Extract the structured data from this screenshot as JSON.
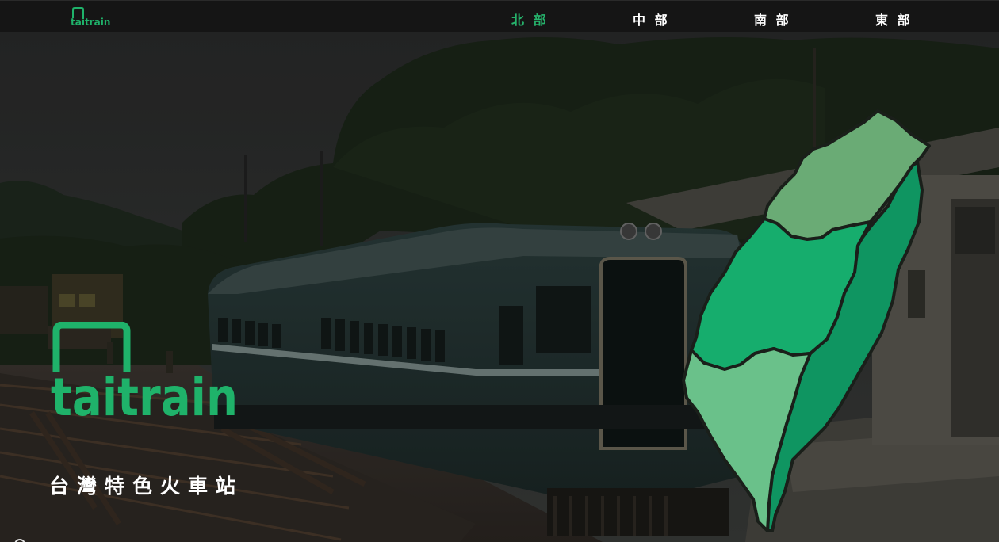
{
  "nav": {
    "logo_text": "taitrain",
    "links": [
      {
        "label": "北 部",
        "active": true
      },
      {
        "label": "中 部",
        "active": false
      },
      {
        "label": "南 部",
        "active": false
      },
      {
        "label": "東 部",
        "active": false
      }
    ]
  },
  "hero": {
    "logo_text": "taitrain",
    "tagline": "台灣特色火車站"
  },
  "map": {
    "regions": [
      "north",
      "central",
      "south",
      "east"
    ]
  },
  "colors": {
    "navbar_bg": "#151515",
    "accent_green": "#26b36c",
    "north_region": "#6aab75",
    "central_region": "#16ad6d",
    "south_region": "#6ac18a",
    "east_region": "#0f9561",
    "brand_green": "#1fb26a"
  }
}
